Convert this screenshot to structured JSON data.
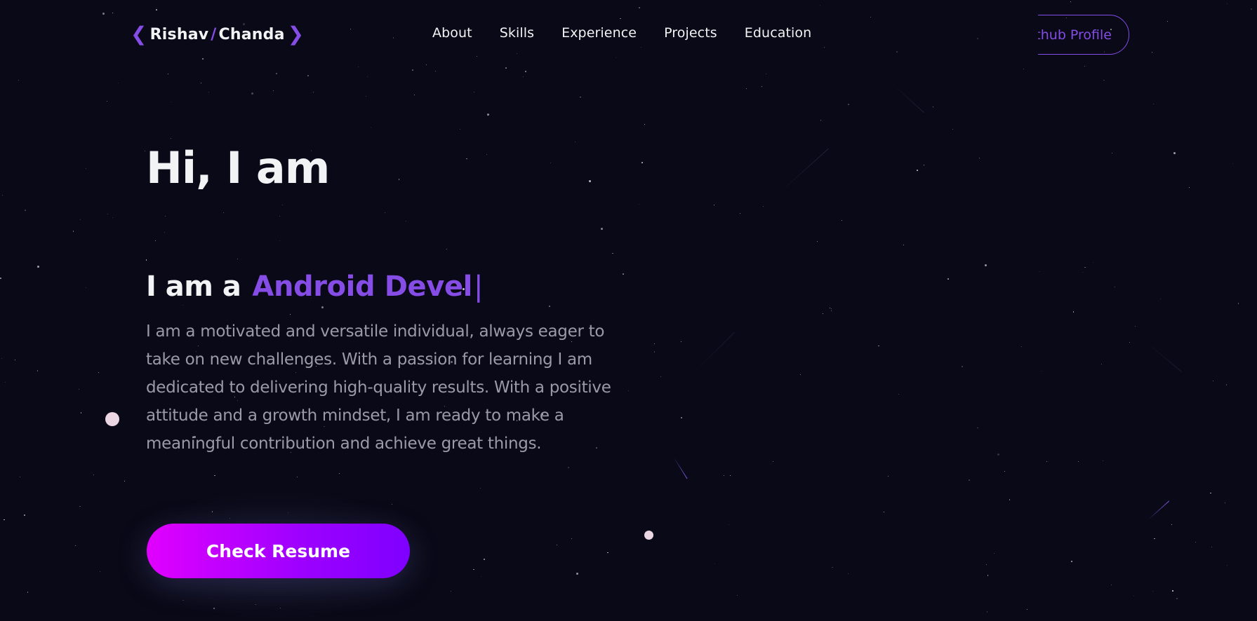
{
  "nav": {
    "logo_first": "Rishav",
    "logo_last": "Chanda",
    "links": [
      "About",
      "Skills",
      "Experience",
      "Projects",
      "Education"
    ],
    "github_button": "Github Profile"
  },
  "hero": {
    "greeting": "Hi, I am",
    "role_prefix": "I am a",
    "role_typed": "Android Devel",
    "cursor": "|",
    "bio": "I am a motivated and versatile individual, always eager to take on new challenges. With a passion for learning I am dedicated to delivering high-quality results. With a positive attitude and a growth mindset, I am ready to make a meaningful contribution and achieve great things.",
    "resume_button": "Check Resume"
  },
  "colors": {
    "background": "#090917",
    "accent": "#854CE6",
    "text_primary": "#F2F3F4",
    "text_secondary": "#9a9aa8",
    "button_gradient_start": "#e100ff",
    "button_gradient_end": "#7f00ff"
  },
  "icons": [
    "chevron-left-icon",
    "chevron-right-icon"
  ]
}
